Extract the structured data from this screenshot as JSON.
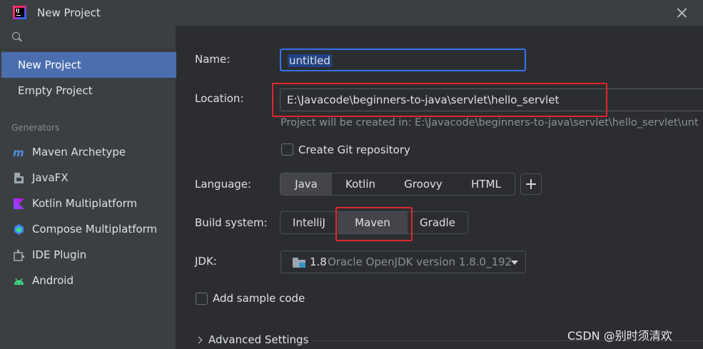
{
  "window": {
    "title": "New Project"
  },
  "sidebar": {
    "search_placeholder": "",
    "items": [
      {
        "label": "New Project",
        "selected": true
      },
      {
        "label": "Empty Project",
        "selected": false
      }
    ],
    "generators_label": "Generators",
    "generators": [
      {
        "label": "Maven Archetype",
        "icon": "maven-icon"
      },
      {
        "label": "JavaFX",
        "icon": "javafx-icon"
      },
      {
        "label": "Kotlin Multiplatform",
        "icon": "kotlin-icon"
      },
      {
        "label": "Compose Multiplatform",
        "icon": "compose-icon"
      },
      {
        "label": "IDE Plugin",
        "icon": "plugin-icon"
      },
      {
        "label": "Android",
        "icon": "android-icon"
      }
    ]
  },
  "form": {
    "name_label": "Name:",
    "name_value": "untitled",
    "location_label": "Location:",
    "location_value": "E:\\Javacode\\beginners-to-java\\servlet\\hello_servlet",
    "location_hint": "Project will be created in: E:\\Javacode\\beginners-to-java\\servlet\\hello_servlet\\unt",
    "git_label": "Create Git repository",
    "git_checked": false,
    "language_label": "Language:",
    "languages": [
      "Java",
      "Kotlin",
      "Groovy",
      "HTML"
    ],
    "language_selected": "Java",
    "build_label": "Build system:",
    "build_systems": [
      "IntelliJ",
      "Maven",
      "Gradle"
    ],
    "build_selected": "Maven",
    "jdk_label": "JDK:",
    "jdk_version": "1.8",
    "jdk_description": "Oracle OpenJDK version 1.8.0_192",
    "sample_code_label": "Add sample code",
    "sample_code_checked": false,
    "advanced_label": "Advanced Settings"
  },
  "colors": {
    "selection": "#4b6eaf",
    "focus_border": "#3574f0",
    "annotation_red": "#e0262c"
  },
  "watermark": "CSDN @别时须清欢"
}
